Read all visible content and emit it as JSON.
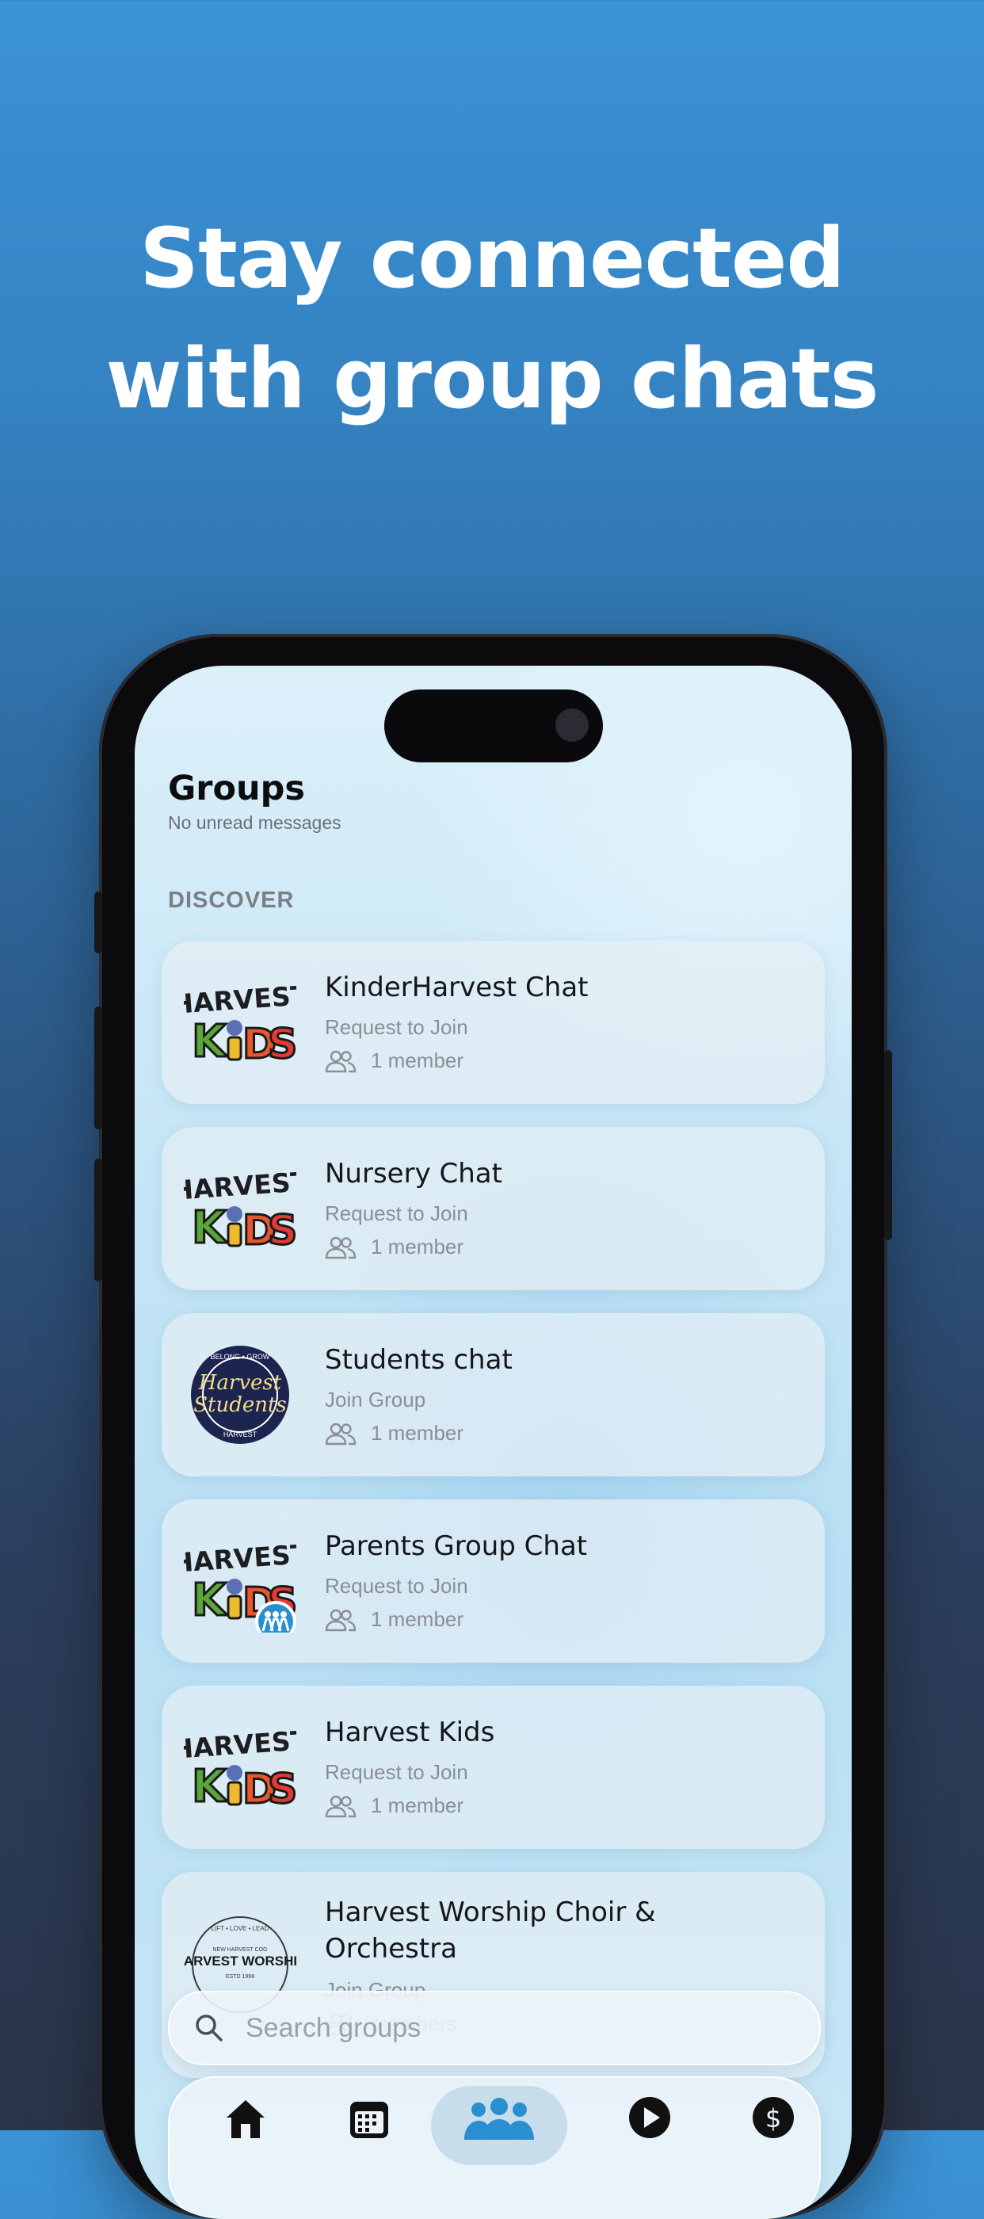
{
  "headline": {
    "line1": "Stay connected",
    "line2": "with group chats"
  },
  "header": {
    "title": "Groups",
    "subtitle": "No unread messages"
  },
  "section": {
    "label": "DISCOVER"
  },
  "groups": [
    {
      "name": "KinderHarvest Chat",
      "action": "Request to Join",
      "members": "1 member",
      "logo": "harvest-kids-logo"
    },
    {
      "name": "Nursery Chat",
      "action": "Request to Join",
      "members": "1 member",
      "logo": "harvest-kids-logo"
    },
    {
      "name": "Students chat",
      "action": "Join Group",
      "members": "1 member",
      "logo": "harvest-students-logo"
    },
    {
      "name": "Parents Group Chat",
      "action": "Request to Join",
      "members": "1 member",
      "logo": "harvest-kids-logo"
    },
    {
      "name": "Harvest Kids",
      "action": "Request to Join",
      "members": "1 member",
      "logo": "harvest-kids-logo"
    },
    {
      "name": "Harvest Worship Choir & Orchestra",
      "action": "Join Group",
      "members": "members",
      "logo": "harvest-worship-logo"
    }
  ],
  "logos": {
    "harvest_kids": {
      "top": "HARVEST",
      "bottom": "KIDS"
    },
    "harvest_students": {
      "arc_top": "BELONG • GROW",
      "script": "Harvest Students",
      "arc_bottom": "HARVEST"
    },
    "harvest_worship": {
      "arc_top": "LIFT • LOVE • LEAD",
      "sub": "NEW HARVEST COG",
      "main": "HARVEST WORSHIP",
      "est": "ESTD 1998"
    }
  },
  "search": {
    "placeholder": "Search groups"
  },
  "tabs": [
    {
      "icon": "home-icon"
    },
    {
      "icon": "calendar-icon"
    },
    {
      "icon": "groups-icon",
      "active": true
    },
    {
      "icon": "play-icon"
    },
    {
      "icon": "giving-icon"
    }
  ],
  "colors": {
    "accent": "#2a8fd0",
    "brand_blue": "#3b93d6"
  }
}
